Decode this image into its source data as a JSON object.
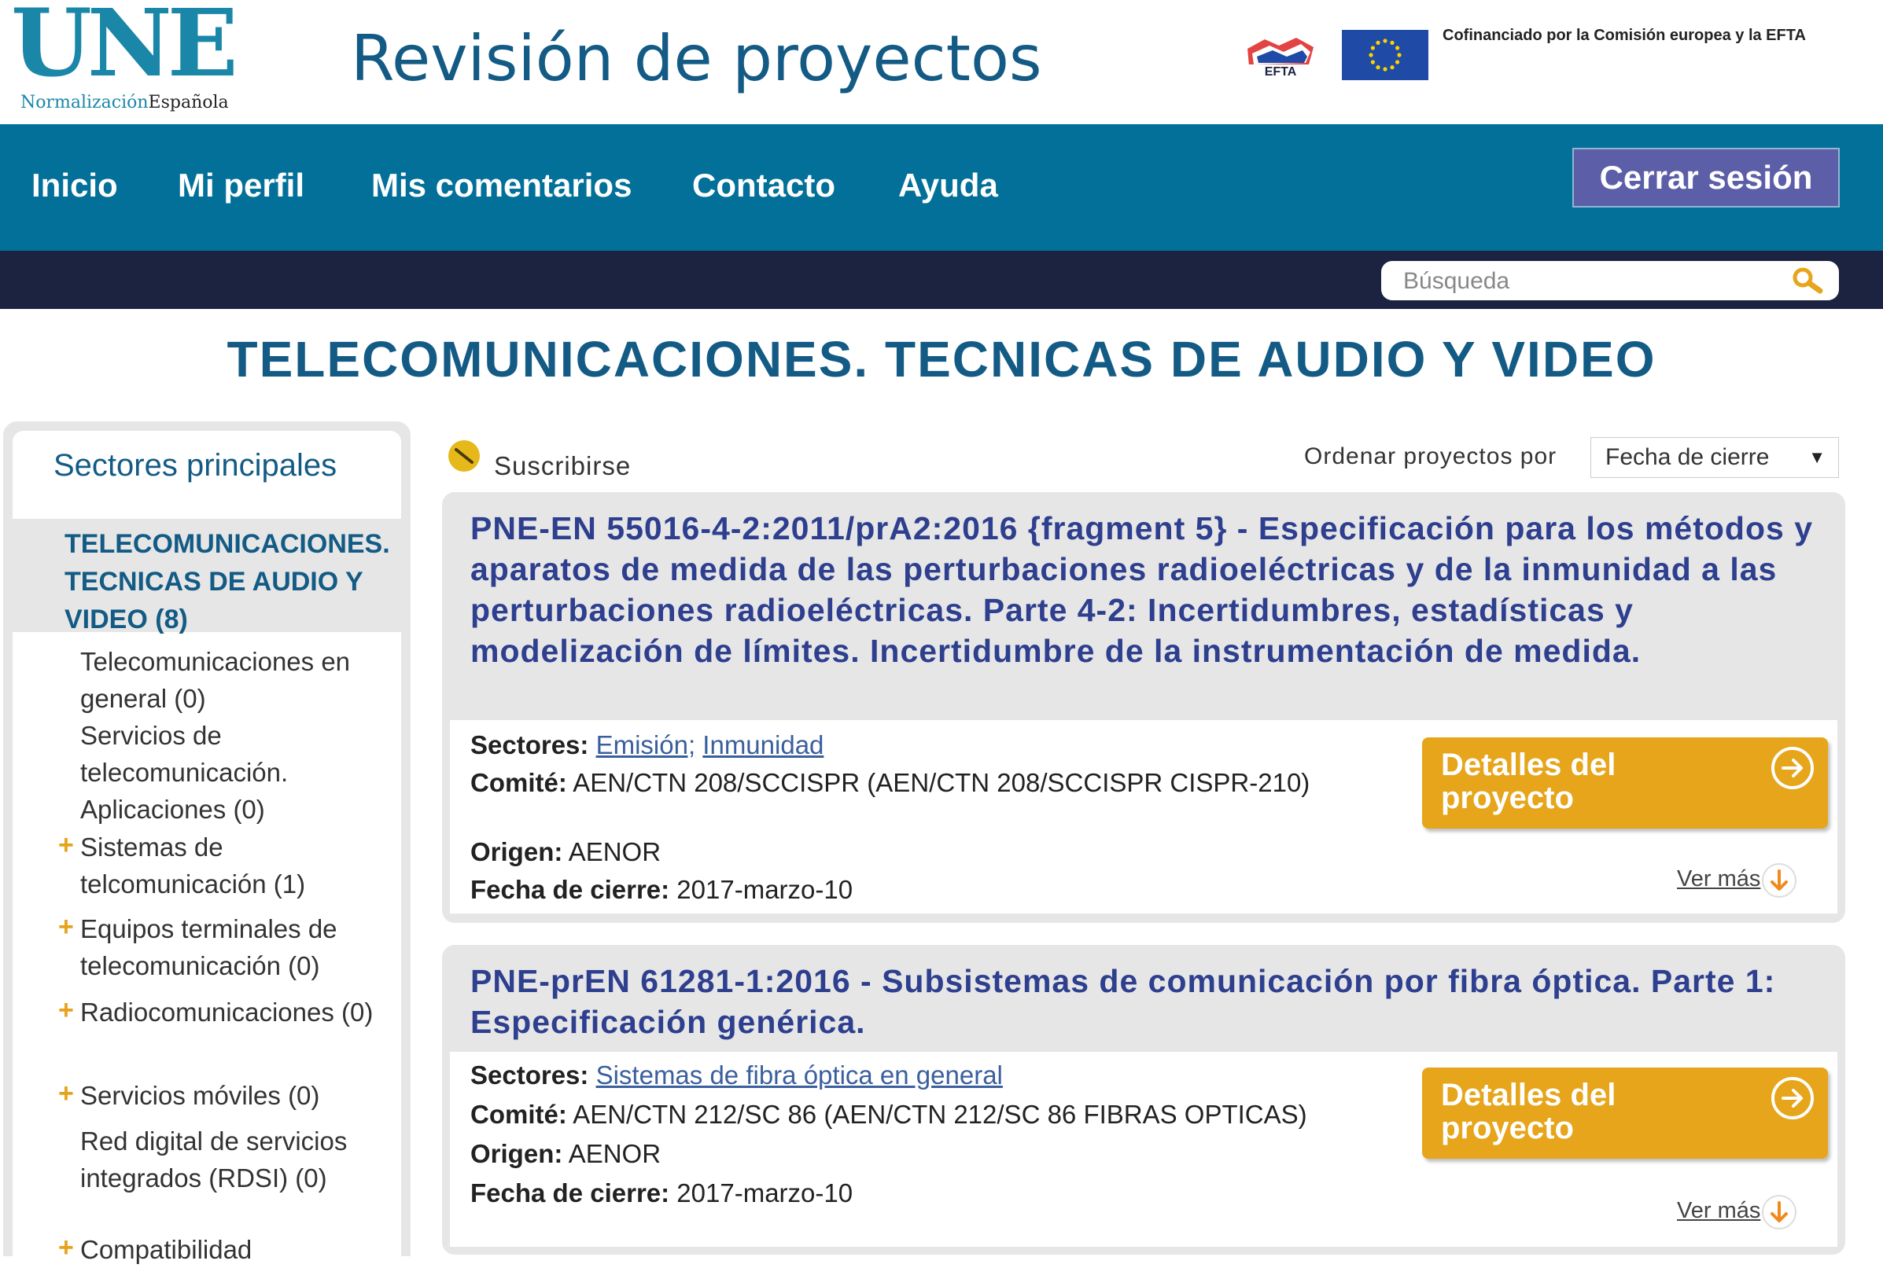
{
  "header": {
    "logo_text": "UNE",
    "logo_sub_1": "Normalización",
    "logo_sub_2": "Española",
    "site_title": "Revisión de proyectos",
    "efta_text": "EFTA",
    "cofin_text": "Cofinanciado por la Comisión europea y la EFTA"
  },
  "nav": {
    "items": [
      "Inicio",
      "Mi perfil",
      "Mis comentarios",
      "Contacto",
      "Ayuda"
    ],
    "logout_label": "Cerrar sesión"
  },
  "search": {
    "placeholder": "Búsqueda",
    "icon": "search-icon"
  },
  "page_title": "TELECOMUNICACIONES. TECNICAS DE AUDIO Y VIDEO",
  "sidebar": {
    "heading": "Sectores principales",
    "active": "TELECOMUNICACIONES. TECNICAS DE AUDIO Y VIDEO (8)",
    "items": [
      {
        "label": "Telecomunicaciones en general (0)",
        "expandable": false
      },
      {
        "label": "Servicios de telecomunicación. Aplicaciones (0)",
        "expandable": false
      },
      {
        "label": "Sistemas de telcomunicación (1)",
        "expandable": true
      },
      {
        "label": "Equipos terminales de telecomunicación (0)",
        "expandable": true
      },
      {
        "label": "Radiocomunicaciones (0)",
        "expandable": true
      },
      {
        "label": "Servicios móviles (0)",
        "expandable": true
      },
      {
        "label": "Red digital de servicios integrados (RDSI) (0)",
        "expandable": false
      },
      {
        "label": "Compatibilidad",
        "expandable": true
      }
    ],
    "plus_symbol": "+"
  },
  "toolbar": {
    "subscribe_label": "Suscribirse",
    "order_label": "Ordenar proyectos por",
    "order_value": "Fecha de cierre",
    "order_arrow": "▼"
  },
  "projects": [
    {
      "title": "PNE-EN 55016-4-2:2011/prA2:2016 {fragment 5} - Especificación para los métodos y aparatos de medida de las perturbaciones radioeléctricas y de la inmunidad a las perturbaciones radioeléctricas. Parte 4-2: Incertidumbres, estadísticas y modelización de límites. Incertidumbre de la instrumentación de medida.",
      "sectores_label": "Sectores:",
      "sectores": [
        "Emisión;",
        "Inmunidad"
      ],
      "comite_label": "Comité:",
      "comite": "AEN/CTN 208/SCCISPR (AEN/CTN 208/SCCISPR CISPR-210)",
      "origen_label": "Origen:",
      "origen": "AENOR",
      "fecha_label": "Fecha de cierre:",
      "fecha": "2017-marzo-10",
      "details_label": "Detalles del proyecto",
      "ver_mas": "Ver más"
    },
    {
      "title": "PNE-prEN 61281-1:2016 - Subsistemas de comunicación por fibra óptica. Parte 1: Especificación genérica.",
      "sectores_label": "Sectores:",
      "sectores": [
        "Sistemas de fibra óptica en general"
      ],
      "comite_label": "Comité:",
      "comite": "AEN/CTN 212/SC 86 (AEN/CTN 212/SC 86 FIBRAS OPTICAS)",
      "origen_label": "Origen:",
      "origen": "AENOR",
      "fecha_label": "Fecha de cierre:",
      "fecha": "2017-marzo-10",
      "details_label": "Detalles del proyecto",
      "ver_mas": "Ver más"
    }
  ],
  "colors": {
    "brand_blue": "#1a87a8",
    "nav_bg": "#03709a",
    "dark_bar": "#1b2340",
    "title_blue": "#135b85",
    "card_title": "#2d3f8e",
    "button_orange": "#e6a51a",
    "logout_bg": "#5c5fa8"
  }
}
